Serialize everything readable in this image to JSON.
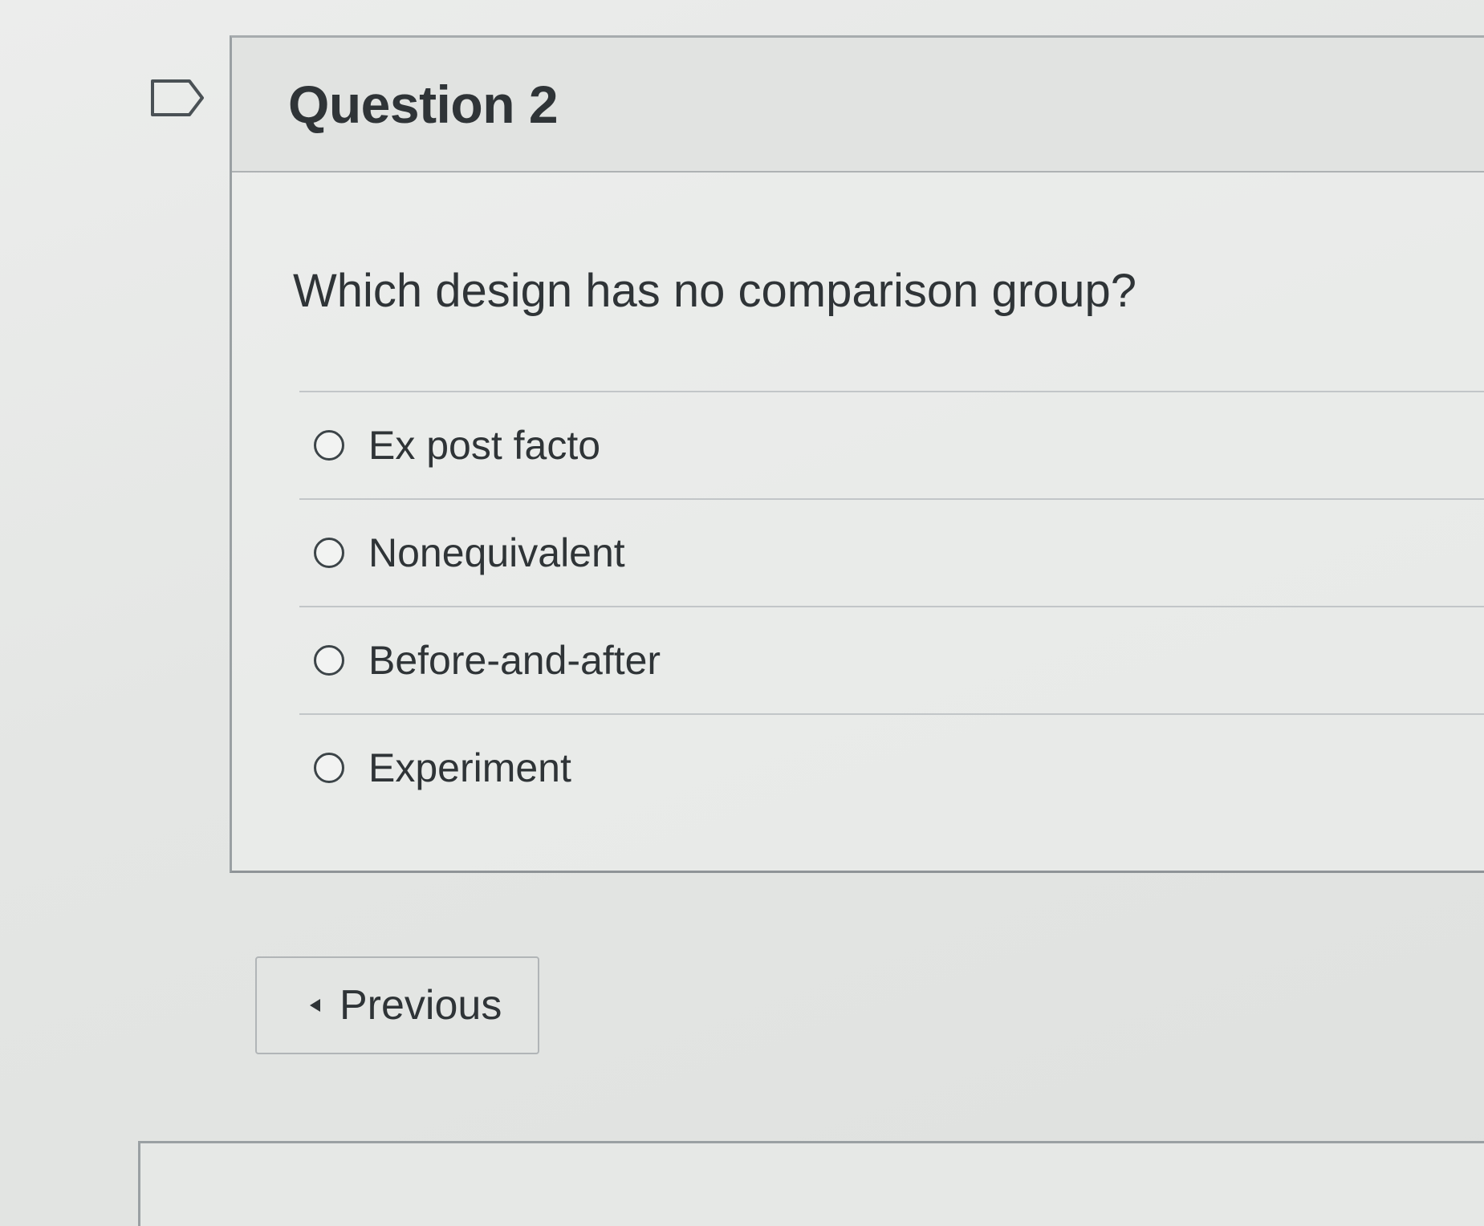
{
  "question": {
    "title": "Question 2",
    "text": "Which design has no comparison group?",
    "flag_icon": "flag-outline-icon"
  },
  "answers": [
    {
      "label": "Ex post facto",
      "selected": false
    },
    {
      "label": "Nonequivalent",
      "selected": false
    },
    {
      "label": "Before-and-after",
      "selected": false
    },
    {
      "label": "Experiment",
      "selected": false
    }
  ],
  "navigation": {
    "previous_label": "Previous",
    "previous_icon": "caret-left-icon"
  }
}
